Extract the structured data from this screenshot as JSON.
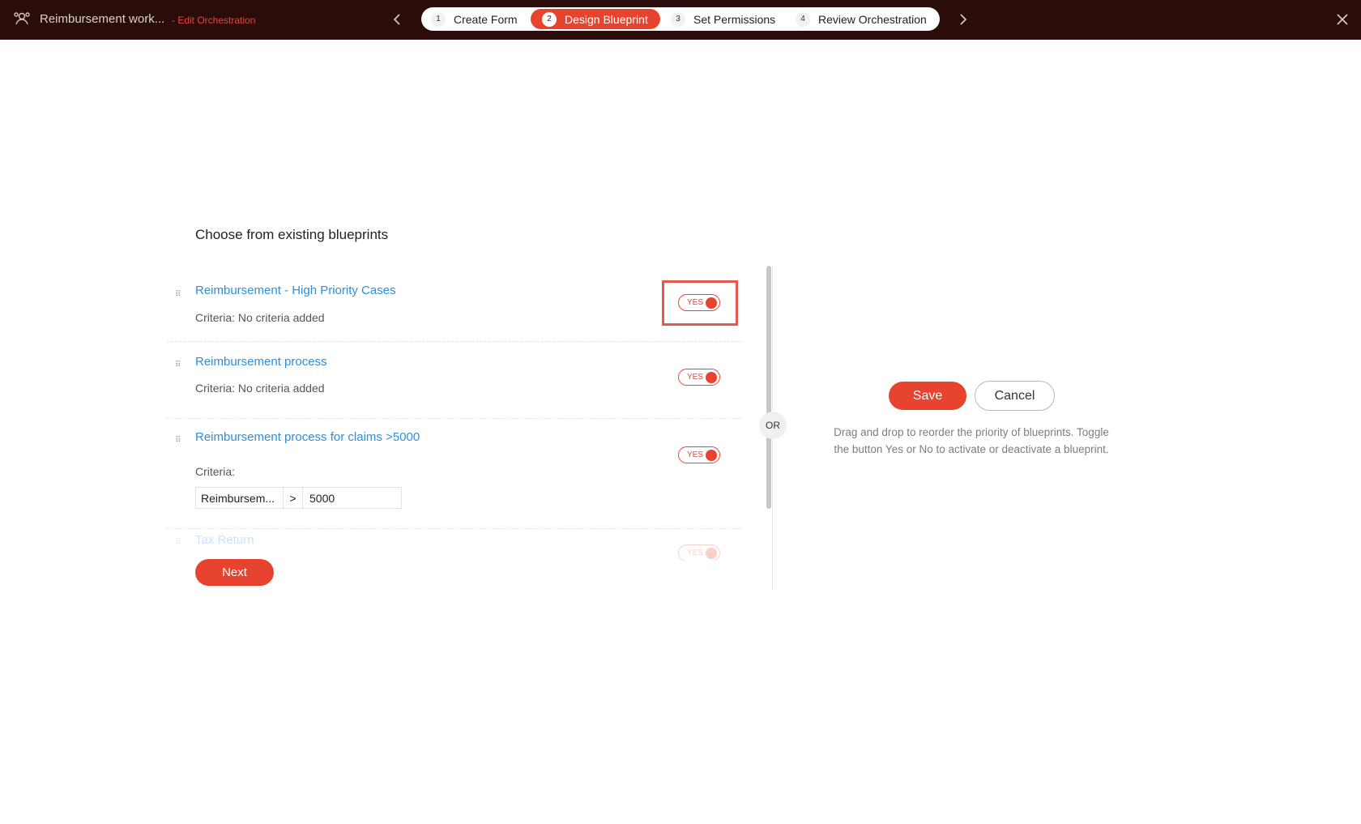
{
  "header": {
    "app_title": "Reimbursement work...",
    "app_subtitle": "- Edit Orchestration",
    "steps": [
      {
        "num": "1",
        "label": "Create Form"
      },
      {
        "num": "2",
        "label": "Design Blueprint"
      },
      {
        "num": "3",
        "label": "Set Permissions"
      },
      {
        "num": "4",
        "label": "Review Orchestration"
      }
    ],
    "active_step": 2
  },
  "main": {
    "section_title": "Choose from existing blueprints",
    "blueprints": [
      {
        "title": "Reimbursement - High Priority Cases",
        "criteria": "Criteria: No criteria added",
        "toggle": "YES"
      },
      {
        "title": "Reimbursement process",
        "criteria": "Criteria: No criteria added",
        "toggle": "YES"
      },
      {
        "title": "Reimbursement process for claims >5000",
        "criteria": "Criteria:",
        "toggle": "YES",
        "criteria_row": {
          "field": "Reimbursem...",
          "operator": ">",
          "value": "5000"
        }
      },
      {
        "title": "Tax Return",
        "toggle": "YES"
      }
    ],
    "next_label": "Next"
  },
  "divider": {
    "or_label": "OR"
  },
  "side": {
    "save_label": "Save",
    "cancel_label": "Cancel",
    "help_text": "Drag and drop to reorder the priority of blueprints. Toggle the button Yes or No to activate or deactivate a blueprint."
  },
  "colors": {
    "accent": "#e8432f",
    "link": "#2f8ed8",
    "topbar": "#2a0d0b"
  }
}
